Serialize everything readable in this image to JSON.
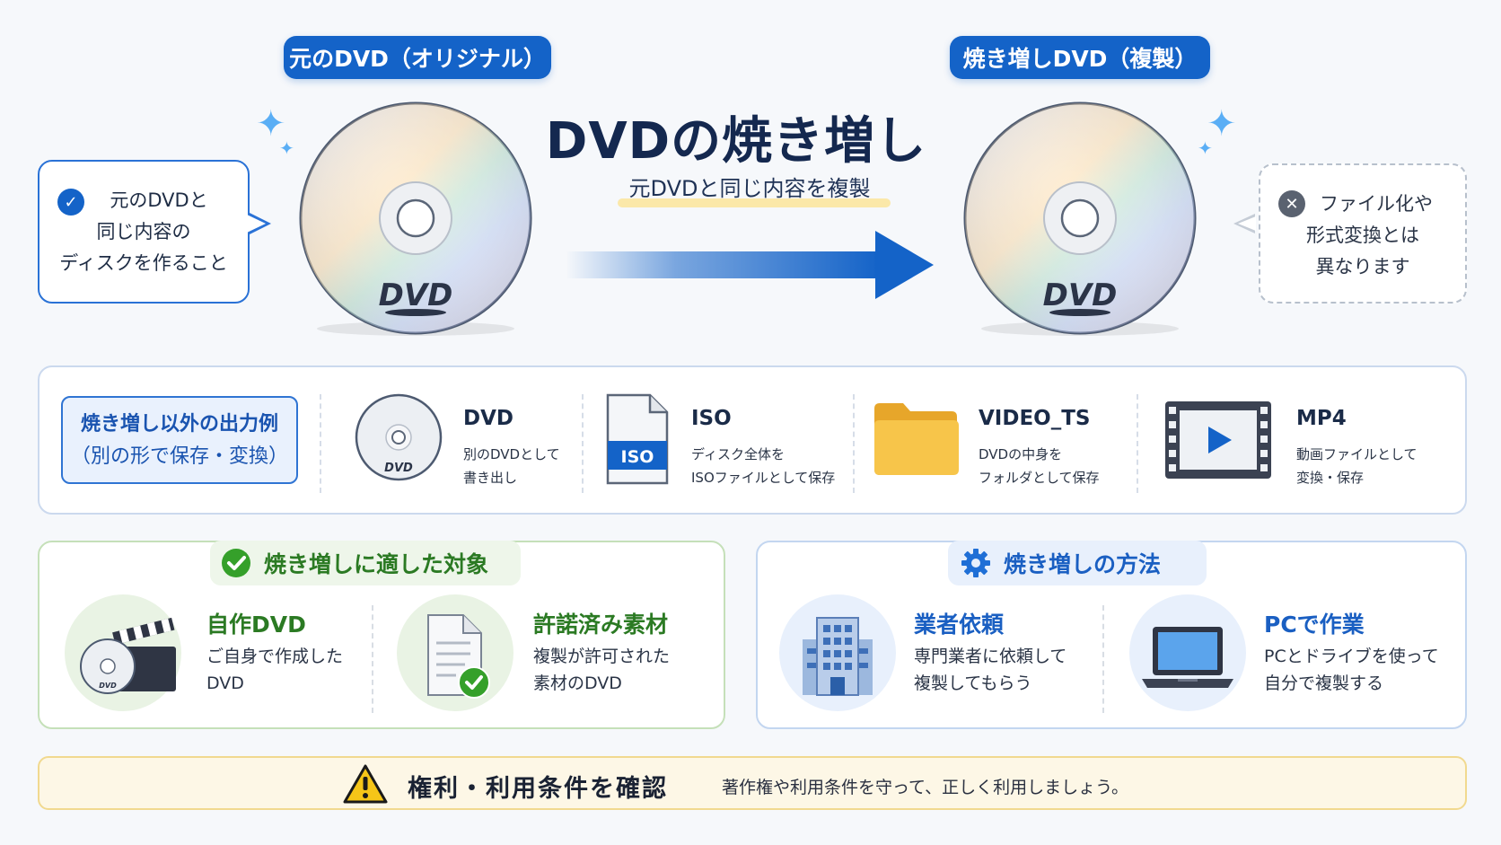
{
  "header": {
    "title": "DVDの焼き増し",
    "subtitle": "元DVDと同じ内容を複製"
  },
  "original": {
    "label": "元のDVD（オリジナル）",
    "disc_logo": "DVD"
  },
  "copy": {
    "label": "焼き増しDVD（複製）",
    "disc_logo": "DVD"
  },
  "definition_bubble": {
    "lines": [
      "元のDVDと",
      "同じ内容の",
      "ディスクを作ること"
    ]
  },
  "difference_bubble": {
    "lines": [
      "ファイル化や",
      "形式変換とは",
      "異なります"
    ]
  },
  "output_examples": {
    "label_line1": "焼き増し以外の出力例",
    "label_line2": "（別の形で保存・変換）",
    "items": [
      {
        "name": "DVD",
        "desc1": "別のDVDとして",
        "desc2": "書き出し",
        "icon": "dvd-disc-icon",
        "icon_text": "DVD"
      },
      {
        "name": "ISO",
        "desc1": "ディスク全体を",
        "desc2": "ISOファイルとして保存",
        "icon": "iso-file-icon",
        "icon_text": "ISO"
      },
      {
        "name": "VIDEO_TS",
        "desc1": "DVDの中身を",
        "desc2": "フォルダとして保存",
        "icon": "folder-icon"
      },
      {
        "name": "MP4",
        "desc1": "動画ファイルとして",
        "desc2": "変換・保存",
        "icon": "video-film-icon"
      }
    ]
  },
  "suitable": {
    "title": "焼き増しに適した対象",
    "items": [
      {
        "title": "自作DVD",
        "desc1": "ご自身で作成した",
        "desc2": "DVD",
        "icon": "dvd-clapperboard-icon",
        "icon_text": "DVD"
      },
      {
        "title": "許諾済み素材",
        "desc1": "複製が許可された",
        "desc2": "素材のDVD",
        "icon": "approved-document-icon"
      }
    ]
  },
  "methods": {
    "title": "焼き増しの方法",
    "items": [
      {
        "title": "業者依頼",
        "desc1": "専門業者に依頼して",
        "desc2": "複製してもらう",
        "icon": "office-building-icon"
      },
      {
        "title": "PCで作業",
        "desc1": "PCとドライブを使って",
        "desc2": "自分で複製する",
        "icon": "laptop-icon"
      }
    ]
  },
  "notice": {
    "title": "権利・利用条件を確認",
    "text": "著作権や利用条件を守って、正しく利用しましょう。"
  },
  "colors": {
    "primary_blue": "#1463c8",
    "navy": "#14284f",
    "green": "#2b7a23",
    "warning_yellow": "#f5c518"
  }
}
